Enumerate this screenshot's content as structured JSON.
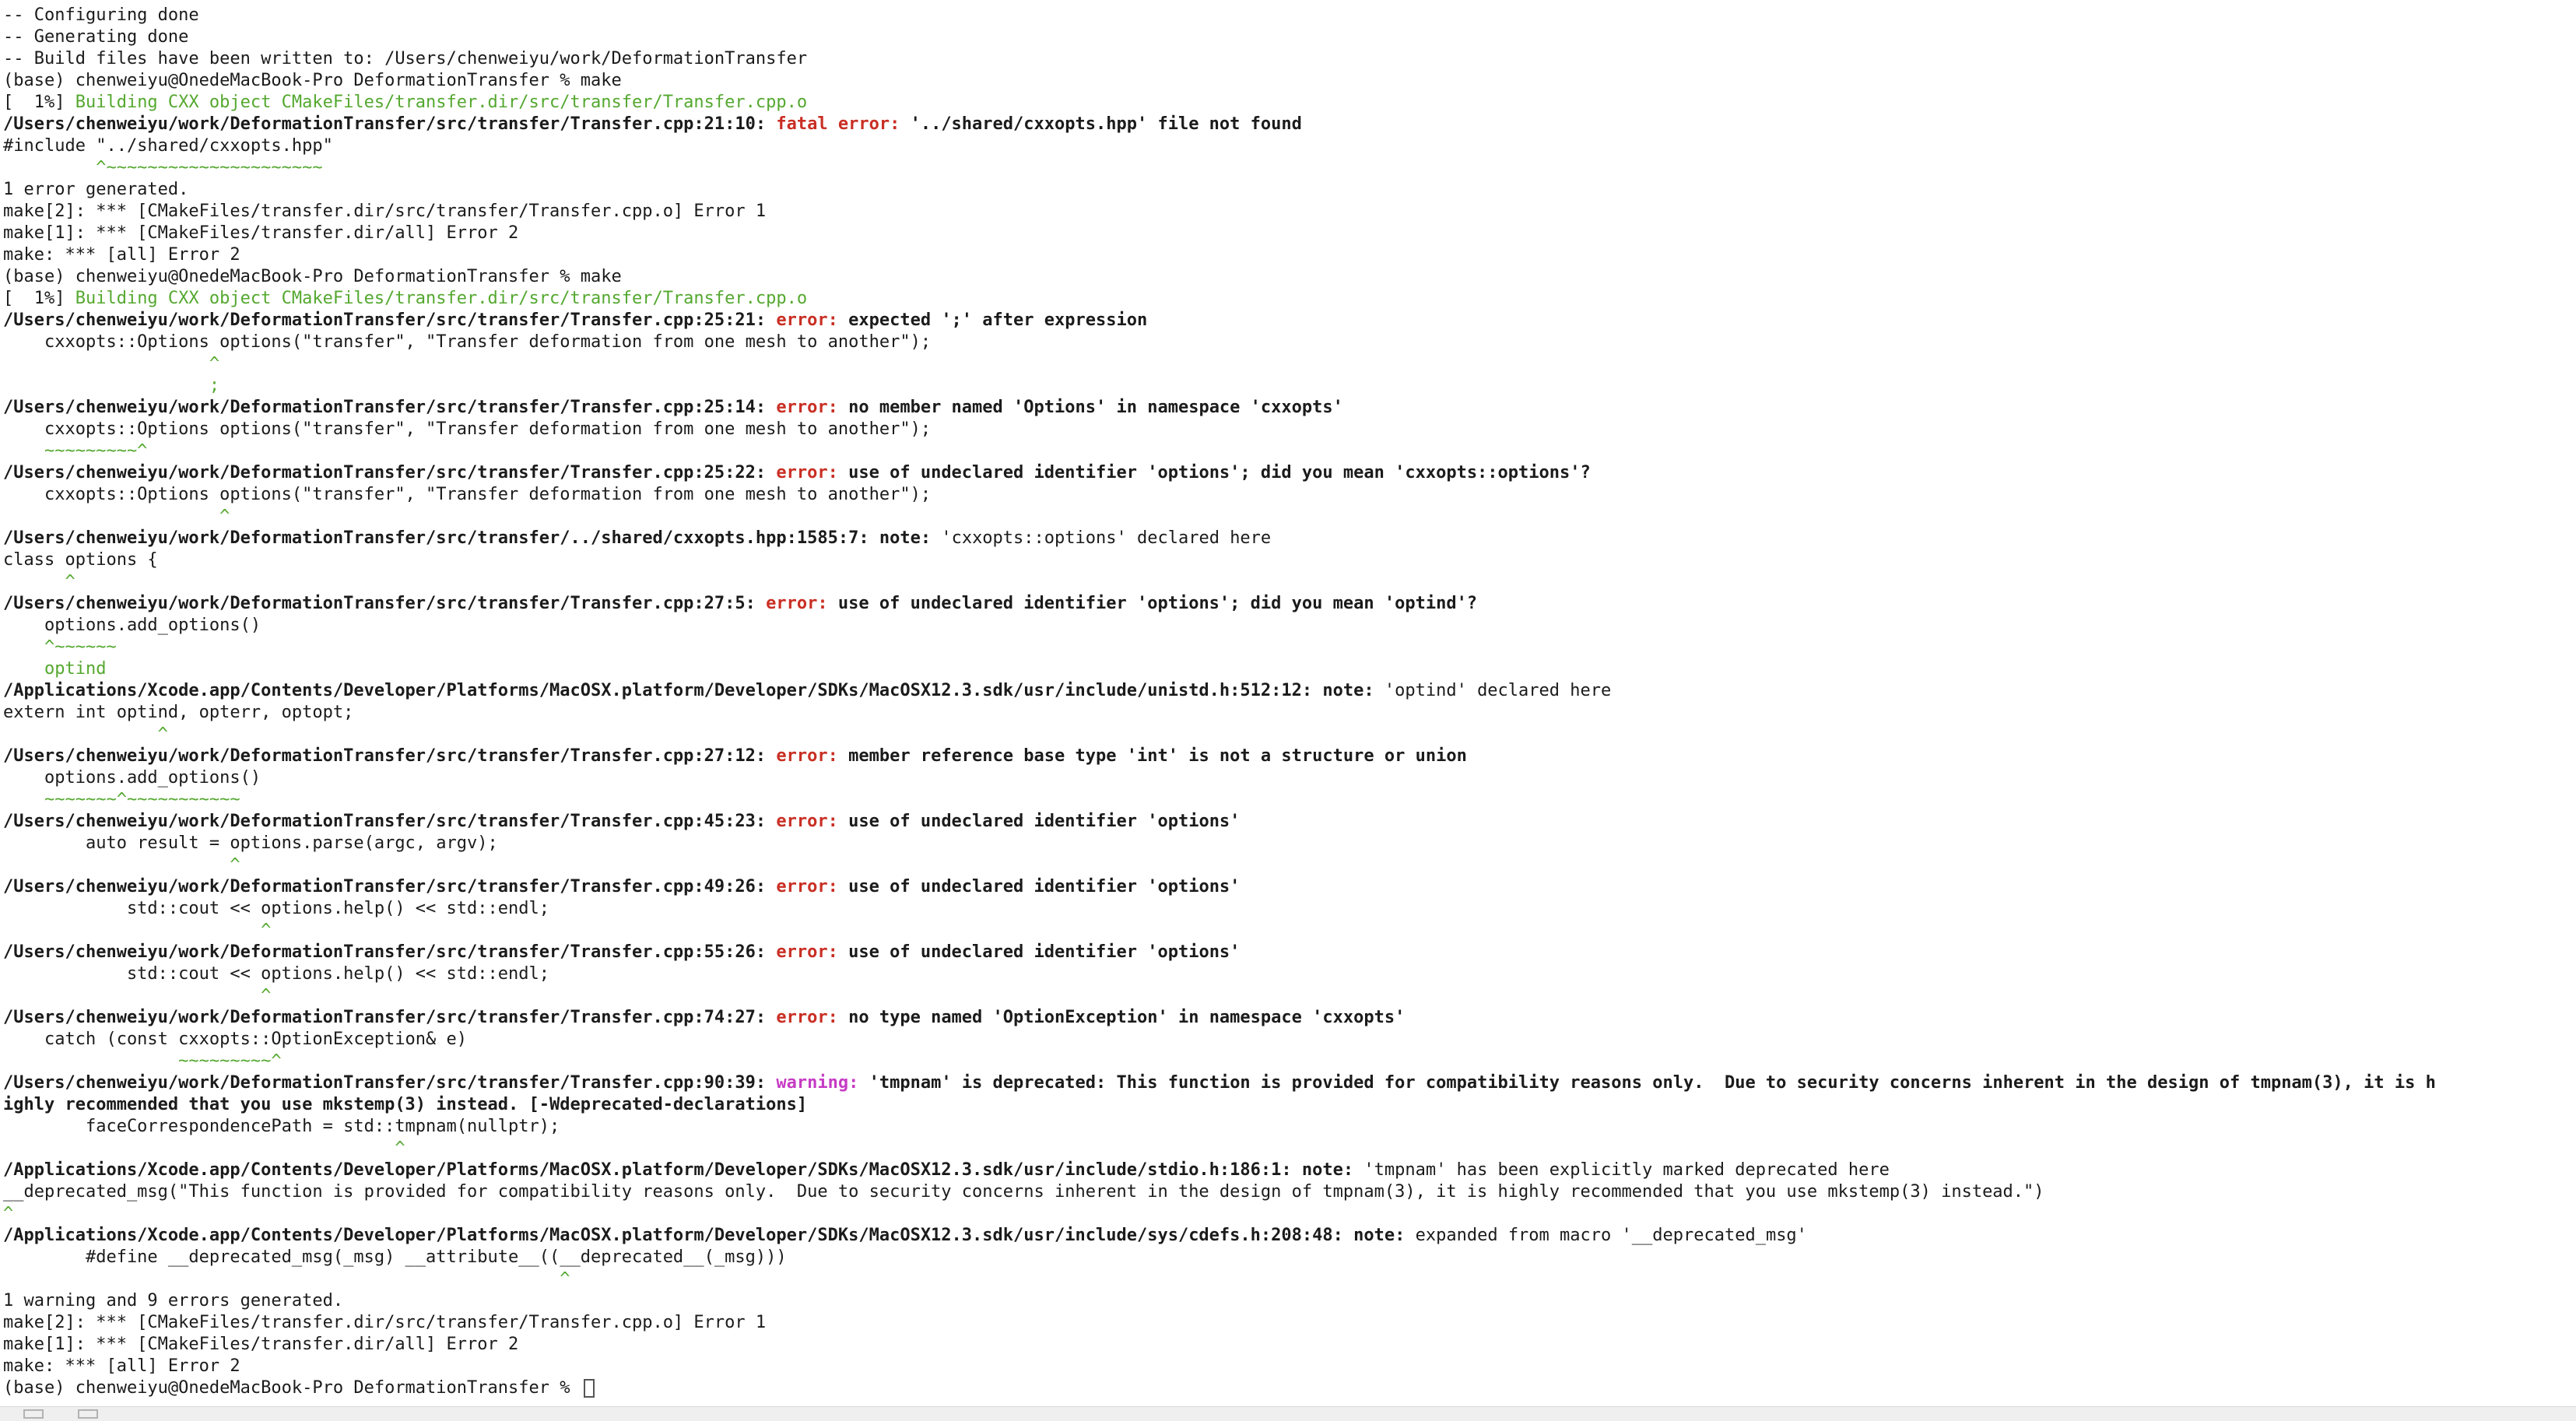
{
  "terminal": {
    "lines": [
      [
        {
          "t": "-- Configuring done",
          "s": "plain"
        }
      ],
      [
        {
          "t": "-- Generating done",
          "s": "plain"
        }
      ],
      [
        {
          "t": "-- Build files have been written to: /Users/chenweiyu/work/DeformationTransfer",
          "s": "plain"
        }
      ],
      [
        {
          "t": "(base) chenweiyu@OnedeMacBook-Pro DeformationTransfer % make",
          "s": "plain"
        }
      ],
      [
        {
          "t": "[  1%] ",
          "s": "plain"
        },
        {
          "t": "Building CXX object CMakeFiles/transfer.dir/src/transfer/Transfer.cpp.o",
          "s": "green"
        }
      ],
      [
        {
          "t": "/Users/chenweiyu/work/DeformationTransfer/src/transfer/Transfer.cpp:21:10: ",
          "s": "bold"
        },
        {
          "t": "fatal error: ",
          "s": "red"
        },
        {
          "t": "'../shared/cxxopts.hpp' file not found",
          "s": "bold"
        }
      ],
      [
        {
          "t": "#include \"../shared/cxxopts.hpp\"",
          "s": "plain"
        }
      ],
      [
        {
          "t": "         ^~~~~~~~~~~~~~~~~~~~~~",
          "s": "green"
        }
      ],
      [
        {
          "t": "1 error generated.",
          "s": "plain"
        }
      ],
      [
        {
          "t": "make[2]: *** [CMakeFiles/transfer.dir/src/transfer/Transfer.cpp.o] Error 1",
          "s": "plain"
        }
      ],
      [
        {
          "t": "make[1]: *** [CMakeFiles/transfer.dir/all] Error 2",
          "s": "plain"
        }
      ],
      [
        {
          "t": "make: *** [all] Error 2",
          "s": "plain"
        }
      ],
      [
        {
          "t": "(base) chenweiyu@OnedeMacBook-Pro DeformationTransfer % make",
          "s": "plain"
        }
      ],
      [
        {
          "t": "[  1%] ",
          "s": "plain"
        },
        {
          "t": "Building CXX object CMakeFiles/transfer.dir/src/transfer/Transfer.cpp.o",
          "s": "green"
        }
      ],
      [
        {
          "t": "/Users/chenweiyu/work/DeformationTransfer/src/transfer/Transfer.cpp:25:21: ",
          "s": "bold"
        },
        {
          "t": "error: ",
          "s": "red"
        },
        {
          "t": "expected ';' after expression",
          "s": "bold"
        }
      ],
      [
        {
          "t": "    cxxopts::Options options(\"transfer\", \"Transfer deformation from one mesh to another\");",
          "s": "plain"
        }
      ],
      [
        {
          "t": "                    ^",
          "s": "green"
        }
      ],
      [
        {
          "t": "                    ;",
          "s": "green"
        }
      ],
      [
        {
          "t": "/Users/chenweiyu/work/DeformationTransfer/src/transfer/Transfer.cpp:25:14: ",
          "s": "bold"
        },
        {
          "t": "error: ",
          "s": "red"
        },
        {
          "t": "no member named 'Options' in namespace 'cxxopts'",
          "s": "bold"
        }
      ],
      [
        {
          "t": "    cxxopts::Options options(\"transfer\", \"Transfer deformation from one mesh to another\");",
          "s": "plain"
        }
      ],
      [
        {
          "t": "    ~~~~~~~~~^",
          "s": "green"
        }
      ],
      [
        {
          "t": "/Users/chenweiyu/work/DeformationTransfer/src/transfer/Transfer.cpp:25:22: ",
          "s": "bold"
        },
        {
          "t": "error: ",
          "s": "red"
        },
        {
          "t": "use of undeclared identifier 'options'; did you mean 'cxxopts::options'?",
          "s": "bold"
        }
      ],
      [
        {
          "t": "    cxxopts::Options options(\"transfer\", \"Transfer deformation from one mesh to another\");",
          "s": "plain"
        }
      ],
      [
        {
          "t": "                     ^",
          "s": "green"
        }
      ],
      [
        {
          "t": "/Users/chenweiyu/work/DeformationTransfer/src/transfer/../shared/cxxopts.hpp:1585:7: ",
          "s": "bold"
        },
        {
          "t": "note: ",
          "s": "bold"
        },
        {
          "t": "'cxxopts::options' declared here",
          "s": "plain"
        }
      ],
      [
        {
          "t": "class options {",
          "s": "plain"
        }
      ],
      [
        {
          "t": "      ^",
          "s": "green"
        }
      ],
      [
        {
          "t": "/Users/chenweiyu/work/DeformationTransfer/src/transfer/Transfer.cpp:27:5: ",
          "s": "bold"
        },
        {
          "t": "error: ",
          "s": "red"
        },
        {
          "t": "use of undeclared identifier 'options'; did you mean 'optind'?",
          "s": "bold"
        }
      ],
      [
        {
          "t": "    options.add_options()",
          "s": "plain"
        }
      ],
      [
        {
          "t": "    ^~~~~~~",
          "s": "green"
        }
      ],
      [
        {
          "t": "    optind",
          "s": "green"
        }
      ],
      [
        {
          "t": "/Applications/Xcode.app/Contents/Developer/Platforms/MacOSX.platform/Developer/SDKs/MacOSX12.3.sdk/usr/include/unistd.h:512:12: ",
          "s": "bold"
        },
        {
          "t": "note: ",
          "s": "bold"
        },
        {
          "t": "'optind' declared here",
          "s": "plain"
        }
      ],
      [
        {
          "t": "extern int optind, opterr, optopt;",
          "s": "plain"
        }
      ],
      [
        {
          "t": "               ^",
          "s": "green"
        }
      ],
      [
        {
          "t": "/Users/chenweiyu/work/DeformationTransfer/src/transfer/Transfer.cpp:27:12: ",
          "s": "bold"
        },
        {
          "t": "error: ",
          "s": "red"
        },
        {
          "t": "member reference base type 'int' is not a structure or union",
          "s": "bold"
        }
      ],
      [
        {
          "t": "    options.add_options()",
          "s": "plain"
        }
      ],
      [
        {
          "t": "    ~~~~~~~^~~~~~~~~~~~",
          "s": "green"
        }
      ],
      [
        {
          "t": "/Users/chenweiyu/work/DeformationTransfer/src/transfer/Transfer.cpp:45:23: ",
          "s": "bold"
        },
        {
          "t": "error: ",
          "s": "red"
        },
        {
          "t": "use of undeclared identifier 'options'",
          "s": "bold"
        }
      ],
      [
        {
          "t": "        auto result = options.parse(argc, argv);",
          "s": "plain"
        }
      ],
      [
        {
          "t": "                      ^",
          "s": "green"
        }
      ],
      [
        {
          "t": "/Users/chenweiyu/work/DeformationTransfer/src/transfer/Transfer.cpp:49:26: ",
          "s": "bold"
        },
        {
          "t": "error: ",
          "s": "red"
        },
        {
          "t": "use of undeclared identifier 'options'",
          "s": "bold"
        }
      ],
      [
        {
          "t": "            std::cout << options.help() << std::endl;",
          "s": "plain"
        }
      ],
      [
        {
          "t": "                         ^",
          "s": "green"
        }
      ],
      [
        {
          "t": "/Users/chenweiyu/work/DeformationTransfer/src/transfer/Transfer.cpp:55:26: ",
          "s": "bold"
        },
        {
          "t": "error: ",
          "s": "red"
        },
        {
          "t": "use of undeclared identifier 'options'",
          "s": "bold"
        }
      ],
      [
        {
          "t": "            std::cout << options.help() << std::endl;",
          "s": "plain"
        }
      ],
      [
        {
          "t": "                         ^",
          "s": "green"
        }
      ],
      [
        {
          "t": "/Users/chenweiyu/work/DeformationTransfer/src/transfer/Transfer.cpp:74:27: ",
          "s": "bold"
        },
        {
          "t": "error: ",
          "s": "red"
        },
        {
          "t": "no type named 'OptionException' in namespace 'cxxopts'",
          "s": "bold"
        }
      ],
      [
        {
          "t": "    catch (const cxxopts::OptionException& e)",
          "s": "plain"
        }
      ],
      [
        {
          "t": "                 ~~~~~~~~~^",
          "s": "green"
        }
      ],
      [
        {
          "t": "/Users/chenweiyu/work/DeformationTransfer/src/transfer/Transfer.cpp:90:39: ",
          "s": "bold"
        },
        {
          "t": "warning: ",
          "s": "magenta"
        },
        {
          "t": "'tmpnam' is deprecated: This function is provided for compatibility reasons only.  Due to security concerns inherent in the design of tmpnam(3), it is h",
          "s": "bold"
        }
      ],
      [
        {
          "t": "ighly recommended that you use mkstemp(3) instead. [-Wdeprecated-declarations]",
          "s": "bold"
        }
      ],
      [
        {
          "t": "        faceCorrespondencePath = std::tmpnam(nullptr);",
          "s": "plain"
        }
      ],
      [
        {
          "t": "                                      ^",
          "s": "green"
        }
      ],
      [
        {
          "t": "/Applications/Xcode.app/Contents/Developer/Platforms/MacOSX.platform/Developer/SDKs/MacOSX12.3.sdk/usr/include/stdio.h:186:1: ",
          "s": "bold"
        },
        {
          "t": "note: ",
          "s": "bold"
        },
        {
          "t": "'tmpnam' has been explicitly marked deprecated here",
          "s": "plain"
        }
      ],
      [
        {
          "t": "__deprecated_msg(\"This function is provided for compatibility reasons only.  Due to security concerns inherent in the design of tmpnam(3), it is highly recommended that you use mkstemp(3) instead.\")",
          "s": "plain"
        }
      ],
      [
        {
          "t": "^",
          "s": "green"
        }
      ],
      [
        {
          "t": "/Applications/Xcode.app/Contents/Developer/Platforms/MacOSX.platform/Developer/SDKs/MacOSX12.3.sdk/usr/include/sys/cdefs.h:208:48: ",
          "s": "bold"
        },
        {
          "t": "note: ",
          "s": "bold"
        },
        {
          "t": "expanded from macro '__deprecated_msg'",
          "s": "plain"
        }
      ],
      [
        {
          "t": "        #define __deprecated_msg(_msg) __attribute__((__deprecated__(_msg)))",
          "s": "plain"
        }
      ],
      [
        {
          "t": "                                                      ^",
          "s": "green"
        }
      ],
      [
        {
          "t": "1 warning and 9 errors generated.",
          "s": "plain"
        }
      ],
      [
        {
          "t": "make[2]: *** [CMakeFiles/transfer.dir/src/transfer/Transfer.cpp.o] Error 1",
          "s": "plain"
        }
      ],
      [
        {
          "t": "make[1]: *** [CMakeFiles/transfer.dir/all] Error 2",
          "s": "plain"
        }
      ],
      [
        {
          "t": "make: *** [all] Error 2",
          "s": "plain"
        }
      ],
      [
        {
          "t": "(base) chenweiyu@OnedeMacBook-Pro DeformationTransfer % ",
          "s": "plain"
        },
        {
          "t": "",
          "s": "cursor"
        }
      ]
    ]
  },
  "colors": {
    "background": "#ffffff",
    "text": "#1b1b1b",
    "green": "#54a82f",
    "error_red": "#c92f24",
    "warning_magenta": "#c63cc4"
  }
}
